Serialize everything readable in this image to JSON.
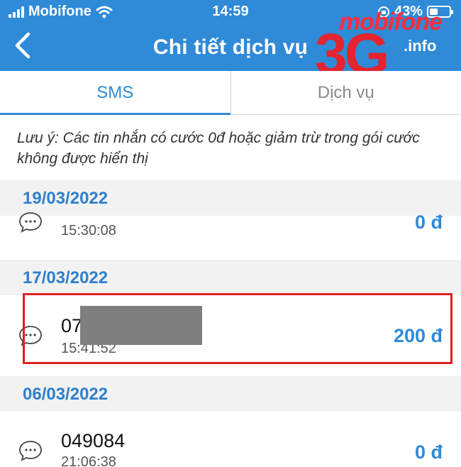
{
  "status_bar": {
    "carrier": "Mobifone",
    "time": "14:59",
    "battery_percent_label": "43%",
    "battery_level": 0.43
  },
  "nav": {
    "title": "Chi tiết dịch vụ"
  },
  "logo": {
    "top_text": "mobifone",
    "main_text": "3G",
    "suffix": ".info"
  },
  "tabs": [
    {
      "label": "SMS",
      "active": true
    },
    {
      "label": "Dịch vụ",
      "active": false
    }
  ],
  "note": "Lưu ý: Các tin nhắn có cước 0đ hoặc giảm trừ trong gói cước không được hiển thị",
  "groups": [
    {
      "date": "19/03/2022",
      "items": [
        {
          "number": "",
          "time": "15:30:08",
          "amount": "0 đ"
        }
      ]
    },
    {
      "date": "17/03/2022",
      "items": [
        {
          "number": "07",
          "time": "15:41:52",
          "amount": "200 đ"
        }
      ]
    },
    {
      "date": "06/03/2022",
      "items": [
        {
          "number": "049084",
          "time": "21:06:38",
          "amount": "0 đ"
        }
      ]
    }
  ],
  "colors": {
    "primary": "#2f8ad8",
    "highlight": "#e02020",
    "logo_red": "#e4242e"
  }
}
